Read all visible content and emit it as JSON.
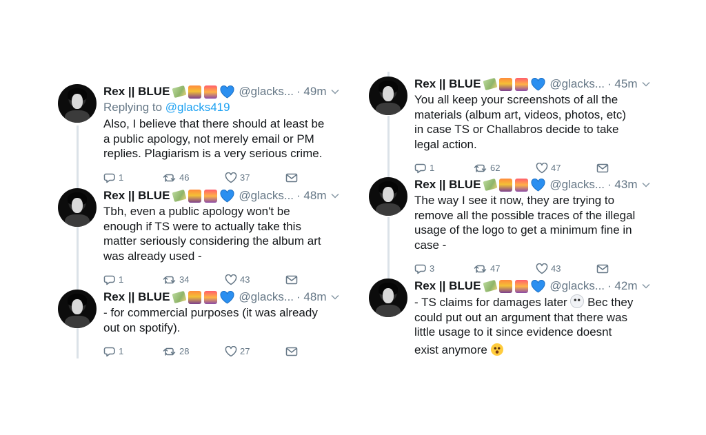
{
  "user": {
    "display_name": "Rex || BLUE",
    "handle": "@glacks...",
    "emoji_icons": [
      "money-with-wings-icon",
      "sunrise-over-mountains-icon",
      "sunset-icon",
      "blue-heart-icon"
    ]
  },
  "left_column": {
    "tweets": [
      {
        "time": "· 49m",
        "replying_prefix": "Replying to ",
        "replying_handle": "@glacks419",
        "lines": [
          "Also, I believe that there should at least be",
          "a public apology, not merely email or PM",
          "replies. Plagiarism is a very serious crime."
        ],
        "replies": "1",
        "retweets": "46",
        "likes": "37"
      },
      {
        "time": "· 48m",
        "lines": [
          "Tbh, even a public apology won't be",
          "enough if TS were to actually take this",
          "matter seriously considering the album art",
          "was already used -"
        ],
        "replies": "1",
        "retweets": "34",
        "likes": "43"
      },
      {
        "time": "· 48m",
        "lines": [
          "- for commercial purposes (it was already",
          "out on spotify)."
        ],
        "replies": "1",
        "retweets": "28",
        "likes": "27"
      }
    ]
  },
  "right_column": {
    "tweets": [
      {
        "time": "· 45m",
        "lines": [
          "You all keep your screenshots of all the",
          "materials (album art, videos, photos, etc)",
          "in case TS or Challabros decide to take",
          "legal action."
        ],
        "replies": "1",
        "retweets": "62",
        "likes": "47"
      },
      {
        "time": "· 43m",
        "lines": [
          "The way I see it now, they are trying to",
          "remove all the possible traces of the illegal",
          "usage of the logo to get a minimum fine in",
          "case -"
        ],
        "replies": "3",
        "retweets": "47",
        "likes": "43"
      },
      {
        "time": "· 42m",
        "line1_a": "- TS claims for damages later",
        "line1_b": " Bec they",
        "lines_mid": [
          "could put out an argument that there was",
          "little usage to it since evidence doesnt"
        ],
        "line_last": "exist anymore",
        "inline_emojis": [
          "ghost-icon",
          "hushed-face-icon"
        ]
      }
    ]
  }
}
